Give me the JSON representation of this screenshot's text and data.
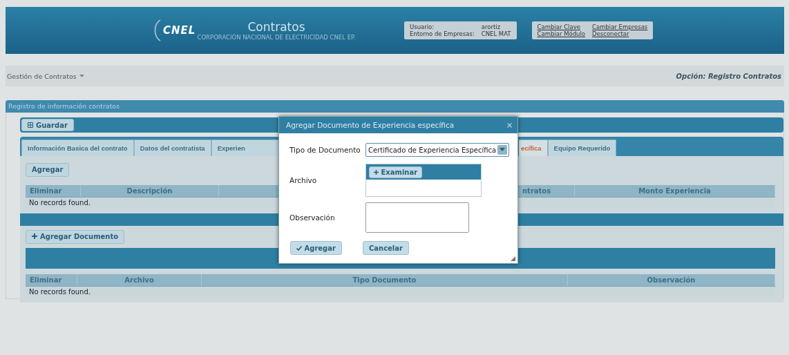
{
  "header": {
    "logo": "CNEL",
    "title": "Contratos",
    "subtitle": "CORPORACIÓN NACIONAL DE ELECTRICIDAD CNEL EP.",
    "user_label": "Usuario:",
    "user": "arortiz",
    "company_label": "Entorno de Empresas:",
    "company": "CNEL MAT",
    "links": [
      "Cambiar Clave",
      "Cambiar Empresas",
      "Cambiar Módulo",
      "Desconectar"
    ]
  },
  "menubar": {
    "menu": "Gestión de Contratos",
    "option": "Opción: Registro Contratos"
  },
  "panel": {
    "title": "Registro de información contratos",
    "save_button": "Guardar",
    "tabs": [
      {
        "label": "Información Basica del contrato",
        "selected": false
      },
      {
        "label": "Datos del contratista",
        "selected": false
      },
      {
        "label": "Experien",
        "selected": false
      },
      {
        "label": "ecífica",
        "selected": true
      },
      {
        "label": "Equipo Requerido",
        "selected": false
      }
    ],
    "add_button": "Agregar",
    "grid_1": {
      "columns": [
        "Eliminar",
        "Descripción",
        "",
        "ntratos",
        "Monto Experiencia"
      ],
      "empty": "No records found."
    },
    "add_document_button": "Agregar Documento",
    "grid_2": {
      "columns": [
        "Eliminar",
        "Archivo",
        "Tipo Documento",
        "Observación"
      ],
      "empty": "No records found."
    }
  },
  "dialog": {
    "title": "Agregar Documento de Experiencia específica",
    "fields": [
      {
        "kind": "select",
        "label": "Tipo de Documento",
        "value": "Certificado de Experiencia Específica"
      },
      {
        "kind": "upload",
        "label": "Archivo",
        "button": "Examinar"
      },
      {
        "kind": "textarea",
        "label": "Observación"
      }
    ],
    "ok_button": "Agregar",
    "cancel_button": "Cancelar"
  }
}
